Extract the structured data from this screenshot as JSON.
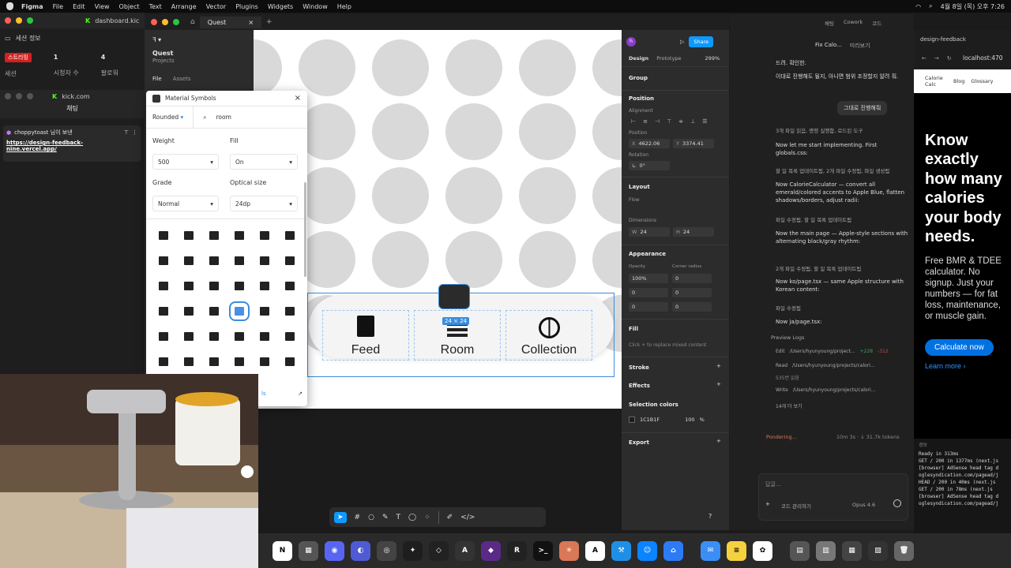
{
  "menubar": {
    "app": "Figma",
    "items": [
      "File",
      "Edit",
      "View",
      "Object",
      "Text",
      "Arrange",
      "Vector",
      "Plugins",
      "Widgets",
      "Window",
      "Help"
    ],
    "clock": "4월 8일 (목) 오후 7:26"
  },
  "leftpanel": {
    "dashboard_tab": "dashboard.kic",
    "session_title": "세션 정보",
    "streaming_badge": "스트리밍",
    "session_label": "세션",
    "viewers_label": "시청자 수",
    "viewers": "1",
    "followers_label": "팔로워",
    "followers": "4",
    "kick_title": "kick.com",
    "chat_title": "채팅",
    "pin_user": "choppytoast 님이 보낸",
    "pin_link": "https://design-feedback-nine.vercel.app/"
  },
  "figma": {
    "tab_title": "Quest",
    "file_name": "Quest",
    "projects_label": "Projects",
    "file_tab": "File",
    "assets_tab": "Assets"
  },
  "popup": {
    "title": "Material Symbols",
    "style": "Rounded",
    "search": "room",
    "weight_label": "Weight",
    "weight": "500",
    "fill_label": "Fill",
    "fill": "On",
    "grade_label": "Grade",
    "grade": "Normal",
    "optical_label": "Optical size",
    "optical": "24dp",
    "footer_link": "ls"
  },
  "canvas": {
    "nav": [
      "Feed",
      "Room",
      "Collection"
    ],
    "size_tag": "24 × 24"
  },
  "props": {
    "design_tab": "Design",
    "prototype_tab": "Prototype",
    "zoom": "299%",
    "share": "Share",
    "group": "Group",
    "position": "Position",
    "alignment": "Alignment",
    "position_sub": "Position",
    "x_label": "X",
    "x": "4622.06",
    "y_label": "Y",
    "y": "3374.41",
    "rotation_label": "Rotation",
    "rotation": "0°",
    "layout": "Layout",
    "flow": "Flow",
    "dimensions": "Dimensions",
    "w_label": "W",
    "w": "24",
    "h_label": "H",
    "h": "24",
    "appearance": "Appearance",
    "opacity_label": "Opacity",
    "corner_label": "Corner radius",
    "opacity": "100%",
    "corner": "0",
    "r1": "0",
    "r2": "0",
    "r3": "0",
    "r4": "0",
    "fill": "Fill",
    "fill_hint": "Click + to replace mixed content",
    "stroke": "Stroke",
    "effects": "Effects",
    "selection_colors": "Selection colors",
    "color_hex": "1C1B1F",
    "color_pct": "100",
    "color_unit": "%",
    "export": "Export"
  },
  "chat": {
    "tab1": "채팅",
    "tab2": "Cowork",
    "tab3": "코드",
    "title": "Fix Calo...",
    "branch": "미리보기",
    "messages": [
      "드려. 확인한.",
      "이대로 진행해도 될지, 아니면 범위 조정할지 알려 줘.",
      "그대로 진행해줘",
      "3개 파일 읽음, 명령 실행함, 로드된 도구",
      "Now let me start implementing. First globals.css:",
      "할 일 목록 업데이트됨, 2개 파일 수정됨, 파일 생성됨",
      "Now CalorieCalculator — convert all emerald/colored accents to Apple Blue, flatten shadows/borders, adjust radii:",
      "파일 수정됨, 할 일 목록 업데이트됨",
      "Now the main page — Apple-style sections with alternating black/gray rhythm:",
      "2개 파일 수정됨, 할 일 목록 업데이트됨",
      "Now ko/page.tsx — same Apple structure with Korean content:",
      "파일 수정됨",
      "Now ja/page.tsx:",
      "Preview Logs",
      "Edit",
      "/Users/hyunyoung/project...",
      "+228",
      "-312",
      "Read",
      "/Users/hyunyoung/projects/calori...",
      "535번 읽음",
      "Write",
      "/Users/hyunyoung/projects/calori...",
      "14개 더 보기"
    ],
    "status": "Pondering...",
    "status_meta": "10m 3s · ↓ 31.7k tokens",
    "input_placeholder": "답글...",
    "mode": "코드 관리하기",
    "model": "Opus 4.6"
  },
  "browser": {
    "tab": "design-feedback",
    "url": "localhost:470",
    "nav": [
      "Calorie Calc",
      "Blog",
      "Glossary"
    ],
    "hero": "Know exactly how many calories your body needs.",
    "sub": "Free BMR & TDEE calculator. No signup. Just your numbers — for fat loss, maintenance, or muscle gain.",
    "cta": "Calculate now",
    "learn": "Learn more ›",
    "log_label": "경보"
  },
  "terminal": [
    "Ready in 313ms",
    "GET / 200 in 1377ms (next.js",
    "[browser] AdSense head tag d",
    "oglesyndication.com/pagead/j",
    "HEAD / 200 in 40ms (next.js",
    "GET / 200 in 78ms (next.js",
    "[browser] AdSense head tag d",
    "oglesyndication.com/pagead/j"
  ]
}
